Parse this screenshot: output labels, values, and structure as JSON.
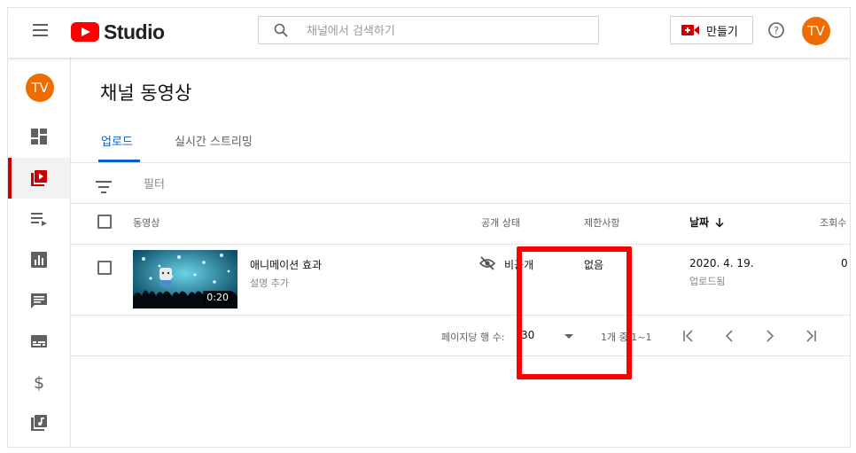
{
  "header": {
    "logo_text": "Studio",
    "search_placeholder": "채널에서 검색하기",
    "create_label": "만들기",
    "avatar_text": "TV"
  },
  "sidebar": {
    "avatar_text": "TV",
    "items": [
      {
        "icon": "dashboard-icon",
        "active": false
      },
      {
        "icon": "videos-icon",
        "active": true
      },
      {
        "icon": "playlists-icon",
        "active": false
      },
      {
        "icon": "analytics-icon",
        "active": false
      },
      {
        "icon": "comments-icon",
        "active": false
      },
      {
        "icon": "subtitles-icon",
        "active": false
      },
      {
        "icon": "monetization-icon",
        "active": false
      },
      {
        "icon": "audio-library-icon",
        "active": false
      }
    ]
  },
  "main": {
    "page_title": "채널 동영상",
    "tabs": [
      {
        "label": "업로드",
        "active": true
      },
      {
        "label": "실시간 스트리밍",
        "active": false
      }
    ],
    "filter_label": "필터",
    "columns": {
      "video": "동영상",
      "visibility": "공개 상태",
      "restrictions": "제한사항",
      "date": "날짜",
      "views": "조회수"
    },
    "rows": [
      {
        "title": "애니메이션 효과",
        "description": "설명 추가",
        "duration": "0:20",
        "visibility": "비공개",
        "restrictions": "없음",
        "date": "2020. 4. 19.",
        "date_status": "업로드됨",
        "views": "0"
      }
    ],
    "pagination": {
      "rows_per_page_label": "페이지당 행 수:",
      "rows_per_page": "30",
      "range_text": "1개 중 1~1"
    }
  },
  "colors": {
    "accent_blue": "#065fd4",
    "brand_red": "#ff0000",
    "avatar_orange": "#ef6c00",
    "highlight_red": "#ff0000"
  }
}
